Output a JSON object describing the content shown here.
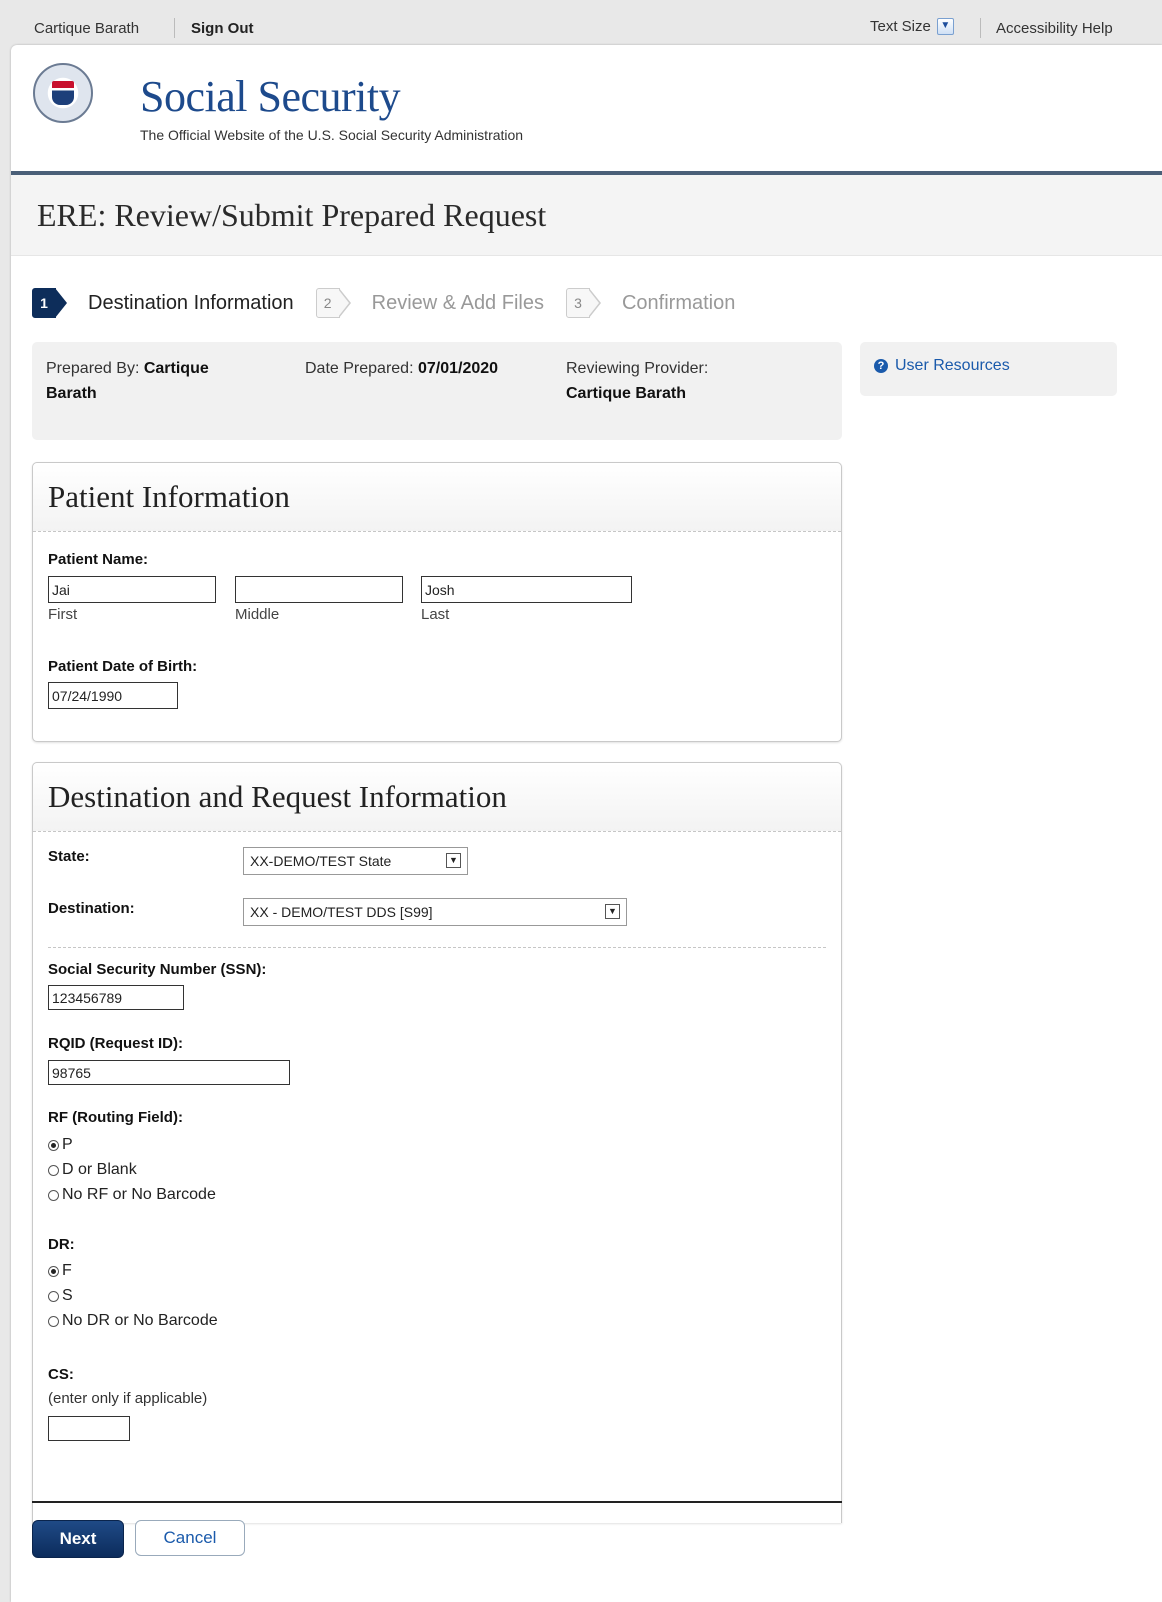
{
  "topbar": {
    "user_name": "Cartique Barath",
    "sign_out": "Sign Out",
    "text_size": "Text Size",
    "accessibility_help": "Accessibility Help"
  },
  "header": {
    "title": "Social Security",
    "subtitle": "The Official Website of the U.S. Social Security Administration"
  },
  "page_title": "ERE: Review/Submit Prepared Request",
  "steps": [
    {
      "num": "1",
      "label": "Destination Information",
      "active": true
    },
    {
      "num": "2",
      "label": "Review & Add Files",
      "active": false
    },
    {
      "num": "3",
      "label": "Confirmation",
      "active": false
    }
  ],
  "prepared": {
    "prepared_by_label": "Prepared By:",
    "prepared_by_first": "Cartique",
    "prepared_by_last": "Barath",
    "date_label": "Date Prepared:",
    "date_value": "07/01/2020",
    "reviewer_label": "Reviewing Provider:",
    "reviewer_value": "Cartique Barath"
  },
  "resources": {
    "link": "User Resources"
  },
  "patient": {
    "heading": "Patient Information",
    "name_label": "Patient Name:",
    "first": "Jai",
    "middle": "",
    "last": "Josh",
    "first_caption": "First",
    "middle_caption": "Middle",
    "last_caption": "Last",
    "dob_label": "Patient Date of Birth:",
    "dob": "07/24/1990"
  },
  "destination": {
    "heading": "Destination and Request Information",
    "state_label": "State:",
    "state_value": "XX-DEMO/TEST State",
    "destination_label": "Destination:",
    "destination_value": "XX - DEMO/TEST DDS [S99]",
    "ssn_label": "Social Security Number (SSN):",
    "ssn": "123456789",
    "rqid_label": "RQID (Request ID):",
    "rqid": "98765",
    "rf_label": "RF (Routing Field):",
    "rf_options": [
      "P",
      "D or Blank",
      "No RF or No Barcode"
    ],
    "rf_selected": "P",
    "dr_label": "DR:",
    "dr_options": [
      "F",
      "S",
      "No DR or No Barcode"
    ],
    "dr_selected": "F",
    "cs_label": "CS:",
    "cs_hint": "(enter only if applicable)",
    "cs": ""
  },
  "buttons": {
    "next": "Next",
    "cancel": "Cancel"
  }
}
